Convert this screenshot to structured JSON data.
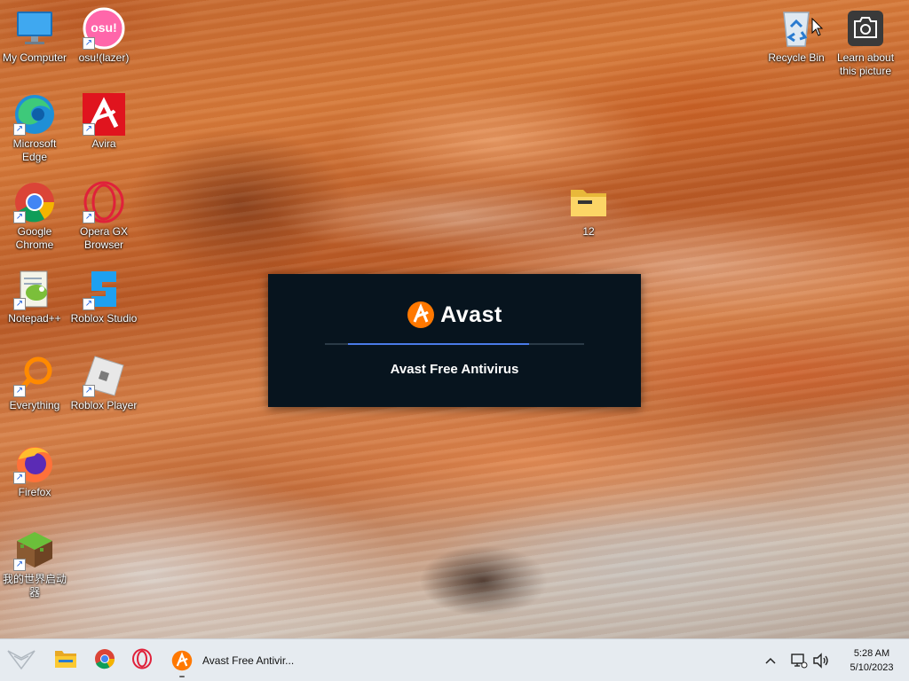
{
  "desktop": {
    "icons": [
      {
        "label": "My Computer",
        "icon": "computer-icon"
      },
      {
        "label": "osu!(lazer)",
        "icon": "osu-icon",
        "glyph": "osu!"
      },
      {
        "label": "Microsoft Edge",
        "icon": "edge-icon"
      },
      {
        "label": "Avira",
        "icon": "avira-icon"
      },
      {
        "label": "Google Chrome",
        "icon": "chrome-icon"
      },
      {
        "label": "Opera GX Browser",
        "icon": "opera-gx-icon"
      },
      {
        "label": "Notepad++",
        "icon": "notepad-plus-plus-icon"
      },
      {
        "label": "Roblox Studio",
        "icon": "roblox-studio-icon"
      },
      {
        "label": "Everything",
        "icon": "everything-search-icon"
      },
      {
        "label": "Roblox Player",
        "icon": "roblox-player-icon"
      },
      {
        "label": "Firefox",
        "icon": "firefox-icon"
      },
      {
        "label": "我的世界启动器",
        "icon": "minecraft-launcher-icon"
      },
      {
        "label": "12",
        "icon": "folder-icon"
      },
      {
        "label": "Recycle Bin",
        "icon": "recycle-bin-icon"
      },
      {
        "label": "Learn about this picture",
        "icon": "camera-icon"
      }
    ],
    "shortcut_glyph": "↗"
  },
  "splash": {
    "brand": "Avast",
    "product": "Avast Free Antivirus",
    "progress": 0.85,
    "accent": "#ff7800",
    "bar_color": "#4a7be8"
  },
  "taskbar": {
    "start_icon": "start-icon",
    "pinned": [
      {
        "name": "file-explorer",
        "icon": "folder-icon"
      },
      {
        "name": "chrome",
        "icon": "chrome-icon"
      },
      {
        "name": "opera",
        "icon": "opera-icon"
      }
    ],
    "active_app": {
      "label": "Avast Free Antivir...",
      "icon": "avast-icon"
    },
    "tray": {
      "chevron": "^",
      "time": "5:28 AM",
      "date": "5/10/2023"
    }
  }
}
